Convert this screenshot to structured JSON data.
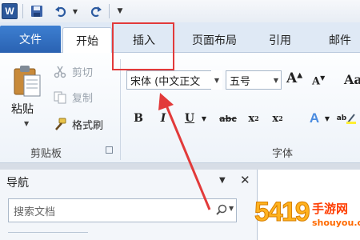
{
  "qat": {
    "logo": "W",
    "icons": [
      "word-logo-icon",
      "save-icon",
      "undo-icon",
      "redo-icon",
      "customize-qat-icon"
    ]
  },
  "tabs": [
    "文件",
    "开始",
    "插入",
    "页面布局",
    "引用",
    "邮件"
  ],
  "clipboard": {
    "paste": "粘贴",
    "cut": "剪切",
    "copy": "复制",
    "format_painter": "格式刷",
    "group_label": "剪贴板"
  },
  "font": {
    "name": "宋体 (中文正文",
    "size": "五号",
    "grow": "A",
    "shrink": "A",
    "clear": "Aa",
    "group_label": "字体"
  },
  "formatting": {
    "bold": "B",
    "italic": "I",
    "underline": "U",
    "strike": "abc",
    "sub": "x",
    "sub_mark": "2",
    "sup": "x",
    "sup_mark": "2",
    "effects": "A",
    "highlight": "ab"
  },
  "nav": {
    "title": "导航",
    "search_placeholder": "搜索文档"
  },
  "watermark": {
    "digits": "5419",
    "name": "手游网",
    "domain": "shouyou.com"
  },
  "colors": {
    "file_tab": "#2a62b2",
    "highlight_box": "#e23a3a",
    "accent": "#ffb21e"
  }
}
